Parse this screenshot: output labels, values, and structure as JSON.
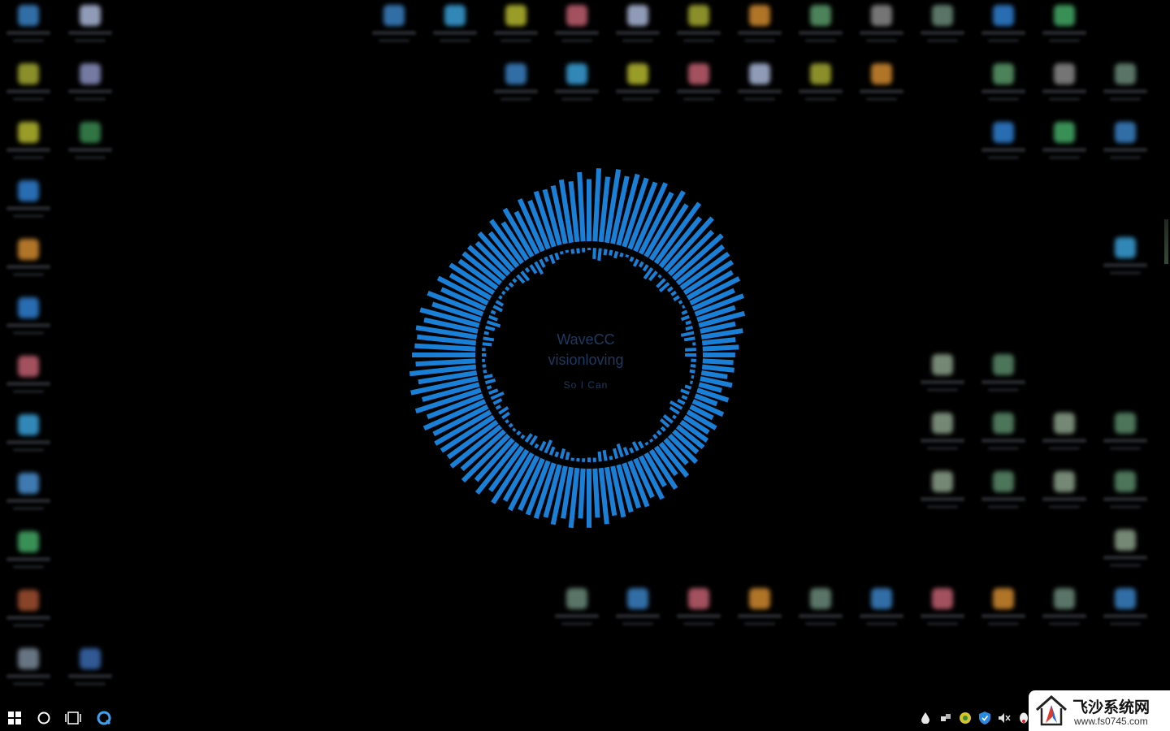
{
  "visualizer": {
    "title": "WaveCC",
    "subtitle": "visionloving",
    "tagline": "So  I Can",
    "bar_color": "#1a7fd6"
  },
  "desktop_icons": [
    {
      "name": "icon-left-1",
      "color": "#3b82c4"
    },
    {
      "name": "icon-left-2",
      "color": "#a3a832"
    },
    {
      "name": "icon-left-3",
      "color": "#b5b830"
    },
    {
      "name": "icon-left-4",
      "color": "#2f7fd0"
    },
    {
      "name": "icon-left-5",
      "color": "#d08a30"
    },
    {
      "name": "icon-left-6",
      "color": "#2f7fd0"
    },
    {
      "name": "icon-left-7",
      "color": "#c06070"
    },
    {
      "name": "icon-left-8",
      "color": "#3aa0d8"
    },
    {
      "name": "icon-left-9",
      "color": "#4a90d0"
    },
    {
      "name": "icon-left-10",
      "color": "#44aa66"
    },
    {
      "name": "icon-left-11",
      "color": "#a05030"
    },
    {
      "name": "icon-left-12",
      "color": "#7a8a9a"
    },
    {
      "name": "icon-col2-1",
      "color": "#aab8d8"
    },
    {
      "name": "icon-col2-2",
      "color": "#8a90c0"
    },
    {
      "name": "icon-col2-3",
      "color": "#3a8a50"
    },
    {
      "name": "icon-col2-4",
      "color": "#3a6ab0"
    }
  ],
  "taskbar": {
    "start_icon": "windows-logo-icon",
    "search_icon": "search-circle-icon",
    "taskview_icon": "task-view-icon",
    "pinned_app_icon": "browser-icon"
  },
  "watermark": {
    "title": "飞沙系统网",
    "url": "www.fs0745.com"
  }
}
